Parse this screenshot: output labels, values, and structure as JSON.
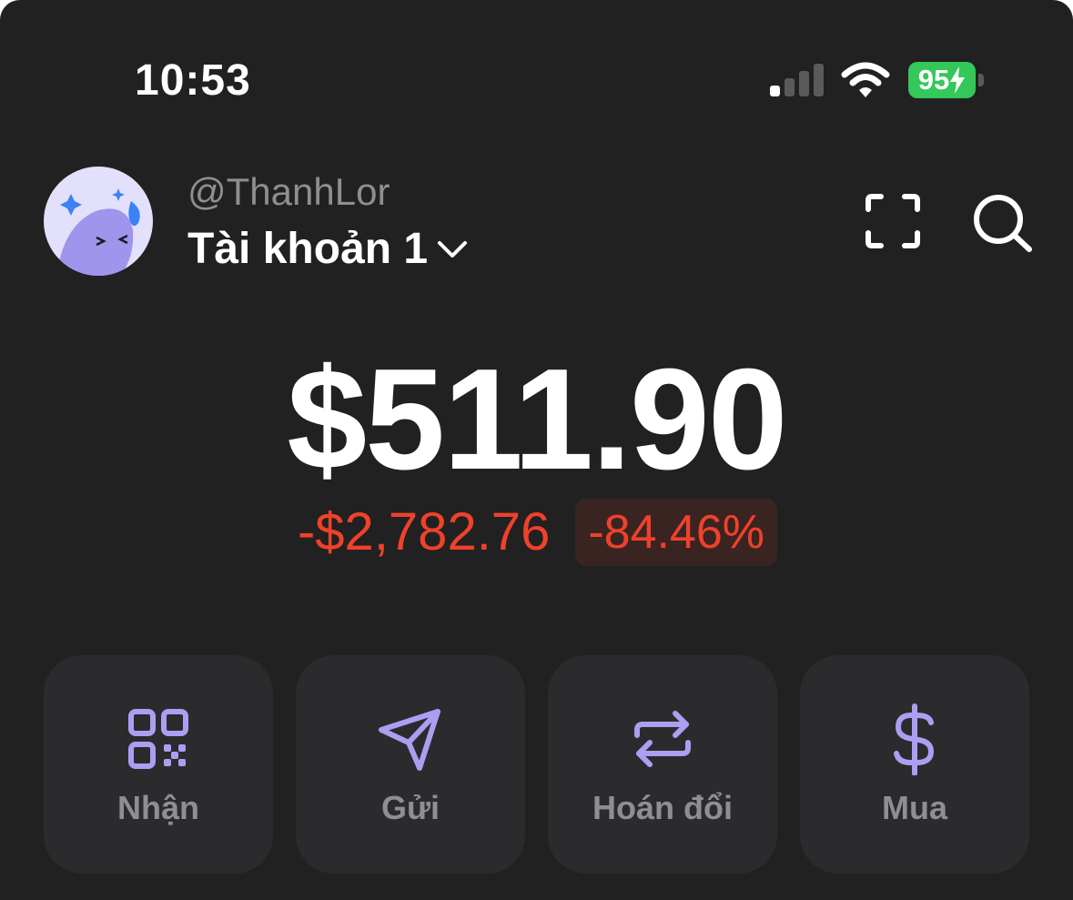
{
  "status_bar": {
    "time": "10:53",
    "battery_percent": "95",
    "battery_color": "#34c759",
    "icons": [
      "cellular-signal-icon",
      "wifi-icon",
      "battery-charging-icon"
    ]
  },
  "header": {
    "handle": "@ThanhLor",
    "account_name": "Tài khoản 1",
    "icons": [
      "avatar",
      "chevron-down-icon",
      "scan-icon",
      "search-icon"
    ]
  },
  "balance": {
    "value": "$511.90",
    "change_amount": "-$2,782.76",
    "change_percent": "-84.46%",
    "negative_color": "#f0412b"
  },
  "actions": [
    {
      "label": "Nhận",
      "icon": "qr-code-icon"
    },
    {
      "label": "Gửi",
      "icon": "send-icon"
    },
    {
      "label": "Hoán đổi",
      "icon": "swap-icon"
    },
    {
      "label": "Mua",
      "icon": "dollar-icon"
    }
  ],
  "colors": {
    "background": "#212121",
    "card": "#2b2b2d",
    "accent": "#ab9ff2",
    "muted_text": "#8e8e93"
  }
}
